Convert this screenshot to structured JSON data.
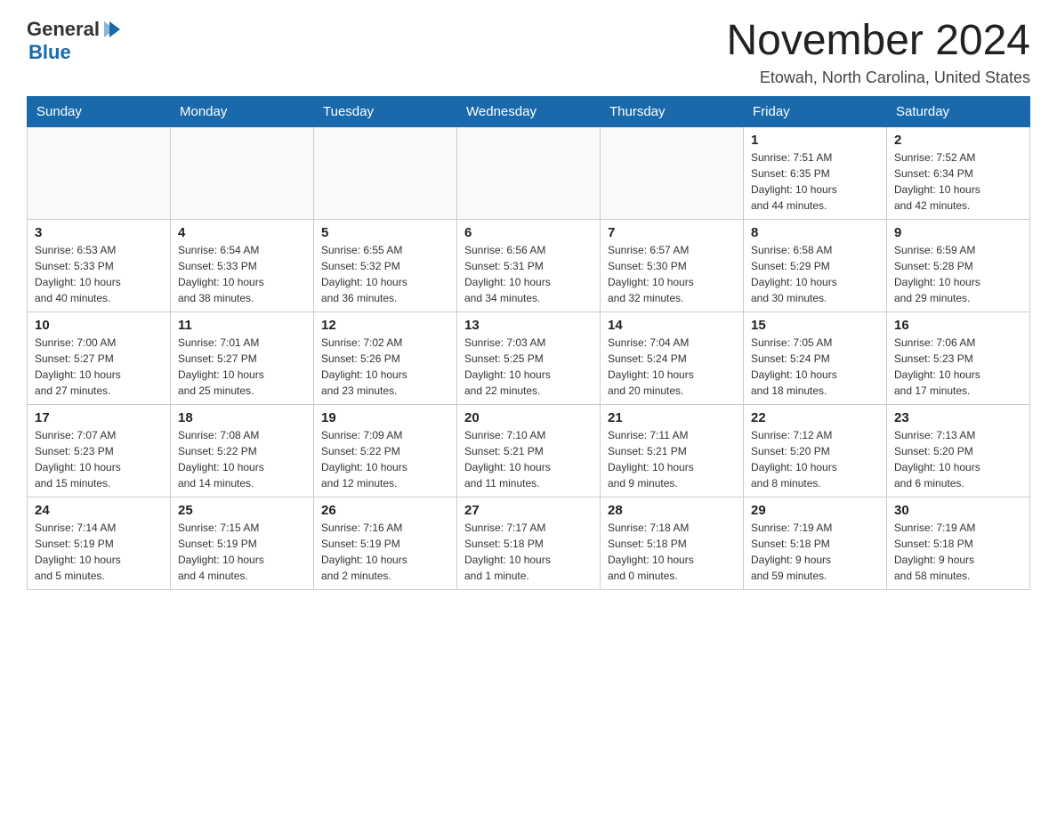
{
  "header": {
    "logo": {
      "general": "General",
      "blue": "Blue",
      "arrow_icon": "▶"
    },
    "title": "November 2024",
    "location": "Etowah, North Carolina, United States"
  },
  "calendar": {
    "days_of_week": [
      "Sunday",
      "Monday",
      "Tuesday",
      "Wednesday",
      "Thursday",
      "Friday",
      "Saturday"
    ],
    "weeks": [
      {
        "days": [
          {
            "number": "",
            "info": ""
          },
          {
            "number": "",
            "info": ""
          },
          {
            "number": "",
            "info": ""
          },
          {
            "number": "",
            "info": ""
          },
          {
            "number": "",
            "info": ""
          },
          {
            "number": "1",
            "info": "Sunrise: 7:51 AM\nSunset: 6:35 PM\nDaylight: 10 hours\nand 44 minutes."
          },
          {
            "number": "2",
            "info": "Sunrise: 7:52 AM\nSunset: 6:34 PM\nDaylight: 10 hours\nand 42 minutes."
          }
        ]
      },
      {
        "days": [
          {
            "number": "3",
            "info": "Sunrise: 6:53 AM\nSunset: 5:33 PM\nDaylight: 10 hours\nand 40 minutes."
          },
          {
            "number": "4",
            "info": "Sunrise: 6:54 AM\nSunset: 5:33 PM\nDaylight: 10 hours\nand 38 minutes."
          },
          {
            "number": "5",
            "info": "Sunrise: 6:55 AM\nSunset: 5:32 PM\nDaylight: 10 hours\nand 36 minutes."
          },
          {
            "number": "6",
            "info": "Sunrise: 6:56 AM\nSunset: 5:31 PM\nDaylight: 10 hours\nand 34 minutes."
          },
          {
            "number": "7",
            "info": "Sunrise: 6:57 AM\nSunset: 5:30 PM\nDaylight: 10 hours\nand 32 minutes."
          },
          {
            "number": "8",
            "info": "Sunrise: 6:58 AM\nSunset: 5:29 PM\nDaylight: 10 hours\nand 30 minutes."
          },
          {
            "number": "9",
            "info": "Sunrise: 6:59 AM\nSunset: 5:28 PM\nDaylight: 10 hours\nand 29 minutes."
          }
        ]
      },
      {
        "days": [
          {
            "number": "10",
            "info": "Sunrise: 7:00 AM\nSunset: 5:27 PM\nDaylight: 10 hours\nand 27 minutes."
          },
          {
            "number": "11",
            "info": "Sunrise: 7:01 AM\nSunset: 5:27 PM\nDaylight: 10 hours\nand 25 minutes."
          },
          {
            "number": "12",
            "info": "Sunrise: 7:02 AM\nSunset: 5:26 PM\nDaylight: 10 hours\nand 23 minutes."
          },
          {
            "number": "13",
            "info": "Sunrise: 7:03 AM\nSunset: 5:25 PM\nDaylight: 10 hours\nand 22 minutes."
          },
          {
            "number": "14",
            "info": "Sunrise: 7:04 AM\nSunset: 5:24 PM\nDaylight: 10 hours\nand 20 minutes."
          },
          {
            "number": "15",
            "info": "Sunrise: 7:05 AM\nSunset: 5:24 PM\nDaylight: 10 hours\nand 18 minutes."
          },
          {
            "number": "16",
            "info": "Sunrise: 7:06 AM\nSunset: 5:23 PM\nDaylight: 10 hours\nand 17 minutes."
          }
        ]
      },
      {
        "days": [
          {
            "number": "17",
            "info": "Sunrise: 7:07 AM\nSunset: 5:23 PM\nDaylight: 10 hours\nand 15 minutes."
          },
          {
            "number": "18",
            "info": "Sunrise: 7:08 AM\nSunset: 5:22 PM\nDaylight: 10 hours\nand 14 minutes."
          },
          {
            "number": "19",
            "info": "Sunrise: 7:09 AM\nSunset: 5:22 PM\nDaylight: 10 hours\nand 12 minutes."
          },
          {
            "number": "20",
            "info": "Sunrise: 7:10 AM\nSunset: 5:21 PM\nDaylight: 10 hours\nand 11 minutes."
          },
          {
            "number": "21",
            "info": "Sunrise: 7:11 AM\nSunset: 5:21 PM\nDaylight: 10 hours\nand 9 minutes."
          },
          {
            "number": "22",
            "info": "Sunrise: 7:12 AM\nSunset: 5:20 PM\nDaylight: 10 hours\nand 8 minutes."
          },
          {
            "number": "23",
            "info": "Sunrise: 7:13 AM\nSunset: 5:20 PM\nDaylight: 10 hours\nand 6 minutes."
          }
        ]
      },
      {
        "days": [
          {
            "number": "24",
            "info": "Sunrise: 7:14 AM\nSunset: 5:19 PM\nDaylight: 10 hours\nand 5 minutes."
          },
          {
            "number": "25",
            "info": "Sunrise: 7:15 AM\nSunset: 5:19 PM\nDaylight: 10 hours\nand 4 minutes."
          },
          {
            "number": "26",
            "info": "Sunrise: 7:16 AM\nSunset: 5:19 PM\nDaylight: 10 hours\nand 2 minutes."
          },
          {
            "number": "27",
            "info": "Sunrise: 7:17 AM\nSunset: 5:18 PM\nDaylight: 10 hours\nand 1 minute."
          },
          {
            "number": "28",
            "info": "Sunrise: 7:18 AM\nSunset: 5:18 PM\nDaylight: 10 hours\nand 0 minutes."
          },
          {
            "number": "29",
            "info": "Sunrise: 7:19 AM\nSunset: 5:18 PM\nDaylight: 9 hours\nand 59 minutes."
          },
          {
            "number": "30",
            "info": "Sunrise: 7:19 AM\nSunset: 5:18 PM\nDaylight: 9 hours\nand 58 minutes."
          }
        ]
      }
    ]
  }
}
